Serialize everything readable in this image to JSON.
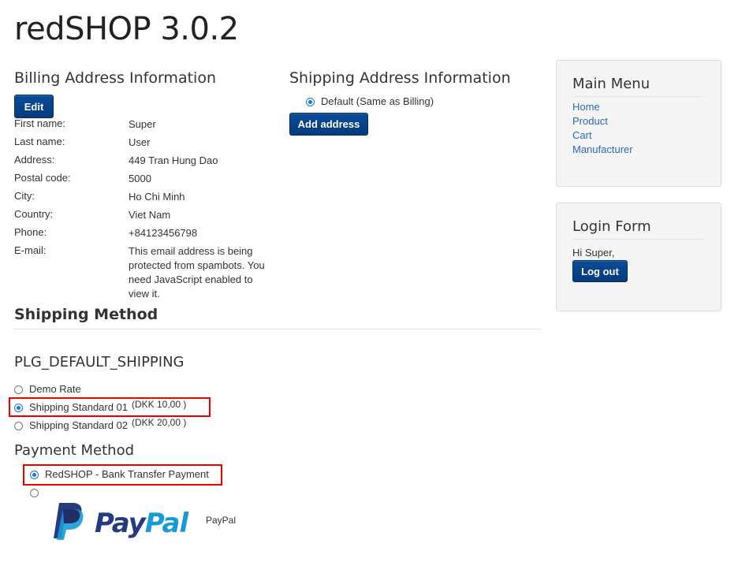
{
  "site": {
    "title": "redSHOP 3.0.2"
  },
  "billing": {
    "heading": "Billing Address Information",
    "edit_label": "Edit",
    "fields": [
      {
        "label": "First name:",
        "value": "Super"
      },
      {
        "label": "Last name:",
        "value": "User"
      },
      {
        "label": "Address:",
        "value": "449 Tran Hung Dao"
      },
      {
        "label": "Postal code:",
        "value": "5000"
      },
      {
        "label": "City:",
        "value": "Ho Chi Minh"
      },
      {
        "label": "Country:",
        "value": "Viet Nam"
      },
      {
        "label": "Phone:",
        "value": "+84123456798"
      },
      {
        "label": "E-mail:",
        "value": "This email address is being protected from spambots. You need JavaScript enabled to view it."
      }
    ]
  },
  "shipping_address": {
    "heading": "Shipping Address Information",
    "default_option": "Default (Same as Billing)",
    "add_label": "Add address"
  },
  "shipping_method": {
    "heading": "Shipping Method",
    "plugin_name": "PLG_DEFAULT_SHIPPING",
    "options": [
      {
        "label": "Demo Rate",
        "price": "",
        "checked": false
      },
      {
        "label": "Shipping Standard 01",
        "price": "(DKK 10,00 )",
        "checked": true
      },
      {
        "label": "Shipping Standard 02",
        "price": "(DKK 20,00 )",
        "checked": false
      }
    ]
  },
  "payment_method": {
    "heading": "Payment Method",
    "options": [
      {
        "label": "RedSHOP - Bank Transfer Payment",
        "checked": true
      },
      {
        "label": "PayPal",
        "checked": false
      }
    ],
    "paypal_logo_text": {
      "pay": "Pay",
      "pal": "Pal"
    },
    "colors": {
      "paypal_dark": "#253b80",
      "paypal_light": "#179bd7"
    }
  },
  "sidebar": {
    "main_menu": {
      "title": "Main Menu",
      "items": [
        "Home",
        "Product",
        "Cart",
        "Manufacturer"
      ]
    },
    "login_form": {
      "title": "Login Form",
      "greeting": "Hi Super,",
      "logout_label": "Log out"
    }
  },
  "colors": {
    "button": "#063a7c",
    "link": "#2a69b8",
    "highlight": "#e00000",
    "radio": "#1a73e8"
  }
}
